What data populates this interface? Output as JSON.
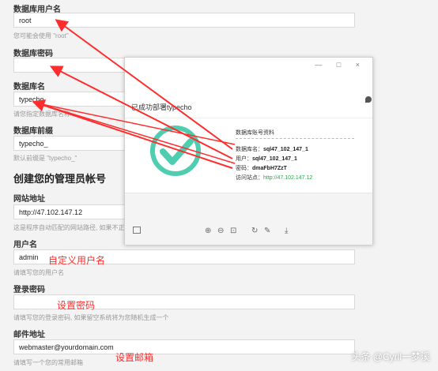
{
  "form": {
    "db_user": {
      "label": "数据库用户名",
      "value": "root",
      "hint": "您可能会使用 \"root\""
    },
    "db_password": {
      "label": "数据库密码",
      "value": ""
    },
    "db_name": {
      "label": "数据库名",
      "value": "typecho",
      "hint": "请您指定数据库名称"
    },
    "db_prefix": {
      "label": "数据库前缀",
      "value": "typecho_",
      "hint": "默认前缀是 \"typecho_\""
    },
    "admin_title": "创建您的管理员帐号",
    "site_url": {
      "label": "网站地址",
      "value": "http://47.102.147.12",
      "hint": "这是程序自动匹配的网站路径, 如果不正确"
    },
    "username": {
      "label": "用户名",
      "value": "admin",
      "hint": "请填写您的用户名"
    },
    "password": {
      "label": "登录密码",
      "value": "",
      "hint": "请填写您的登录密码, 如果留空系统将为您随机生成一个"
    },
    "email": {
      "label": "邮件地址",
      "value": "webmaster@yourdomain.com",
      "hint": "请填写一个您的常用邮箱"
    }
  },
  "annotations": {
    "username": "自定义用户名",
    "password": "设置密码",
    "email": "设置邮箱"
  },
  "modal": {
    "controls": "— □ ×",
    "status": "已成功部署typecho",
    "info_title": "数据库账号资料",
    "rows": [
      {
        "label": "数据库名：",
        "value": "sql47_102_147_1"
      },
      {
        "label": "用户：",
        "value": "sql47_102_147_1"
      },
      {
        "label": "密码：",
        "value": "dmaFbH7ZzT"
      },
      {
        "label": "访问站点：",
        "value": "http://47.102.147.12"
      }
    ],
    "toolbar": [
      "⊕",
      "⊖",
      "⊡",
      "↻",
      "✎",
      "⤓"
    ]
  },
  "watermark": "头条 @Cyril一梦溪",
  "colors": {
    "accent": "#ff2d2d",
    "check": "#4ecdb0",
    "url": "#2aa84a"
  }
}
